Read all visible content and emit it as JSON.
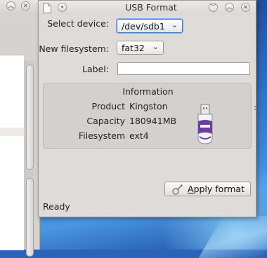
{
  "window": {
    "title": "USB Format",
    "titlebar_buttons": [
      "minimize",
      "maximize",
      "close"
    ]
  },
  "form": {
    "device_label": "Select device:",
    "device_value": "/dev/sdb1",
    "filesystem_label": "New filesystem:",
    "filesystem_value": "fat32",
    "volume_label": "Label:",
    "volume_value": ""
  },
  "info": {
    "title": "Information",
    "product_label": "Product",
    "product_value": "Kingston",
    "capacity_label": "Capacity",
    "capacity_value": "180941MB",
    "filesystem_label": "Filesystem",
    "filesystem_value": "ext4"
  },
  "actions": {
    "apply_prefix": "A",
    "apply_rest": "pply format"
  },
  "status": {
    "text": "Ready"
  },
  "colors": {
    "accent": "#3f79c6",
    "usb_purple": "#6b3fa0"
  }
}
